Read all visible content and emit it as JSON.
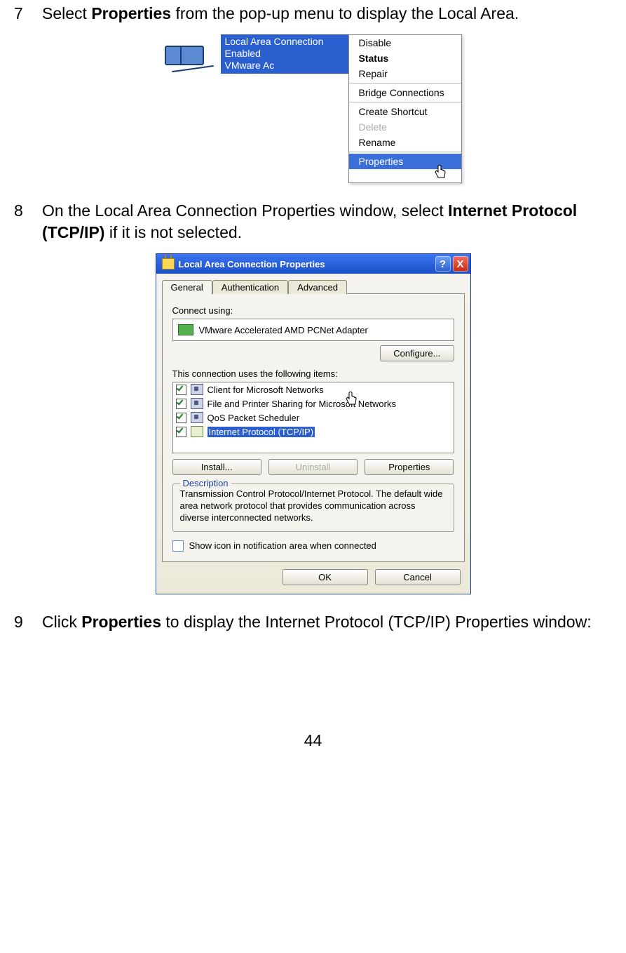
{
  "page_number": "44",
  "step7": {
    "num": "7",
    "pre": "Select ",
    "bold": "Properties",
    "post": " from the pop-up menu to display the Local Area."
  },
  "step8": {
    "num": "8",
    "pre": "On the Local Area Connection Properties window, select ",
    "bold": "Internet Protocol (TCP/IP)",
    "post": " if it is not selected."
  },
  "step9": {
    "num": "9",
    "pre": "Click ",
    "bold": "Properties",
    "post": " to display the Internet Protocol (TCP/IP) Properties window:"
  },
  "fig1": {
    "blue_title": "Local Area Connection",
    "blue_line2": "Enabled",
    "blue_line3": "VMware Ac",
    "menu": {
      "disable": "Disable",
      "status": "Status",
      "repair": "Repair",
      "bridge": "Bridge Connections",
      "shortcut": "Create Shortcut",
      "delete": "Delete",
      "rename": "Rename",
      "properties": "Properties"
    }
  },
  "dialog": {
    "title": "Local Area Connection Properties",
    "tab_general": "General",
    "tab_auth": "Authentication",
    "tab_adv": "Advanced",
    "connect_label": "Connect using:",
    "adapter": "VMware Accelerated AMD PCNet Adapter",
    "configure": "Configure...",
    "uses_label": "This connection uses the following items:",
    "items": {
      "client": "Client for Microsoft Networks",
      "fileshare": "File and Printer Sharing for Microsoft Networks",
      "qos": "QoS Packet Scheduler",
      "tcpip": "Internet Protocol (TCP/IP)"
    },
    "install": "Install...",
    "uninstall": "Uninstall",
    "properties": "Properties",
    "desc_legend": "Description",
    "desc_text": "Transmission Control Protocol/Internet Protocol. The default wide area network protocol that provides communication across diverse interconnected networks.",
    "show_icon": "Show icon in notification area when connected",
    "ok": "OK",
    "cancel": "Cancel",
    "help_symbol": "?",
    "close_symbol": "X"
  }
}
